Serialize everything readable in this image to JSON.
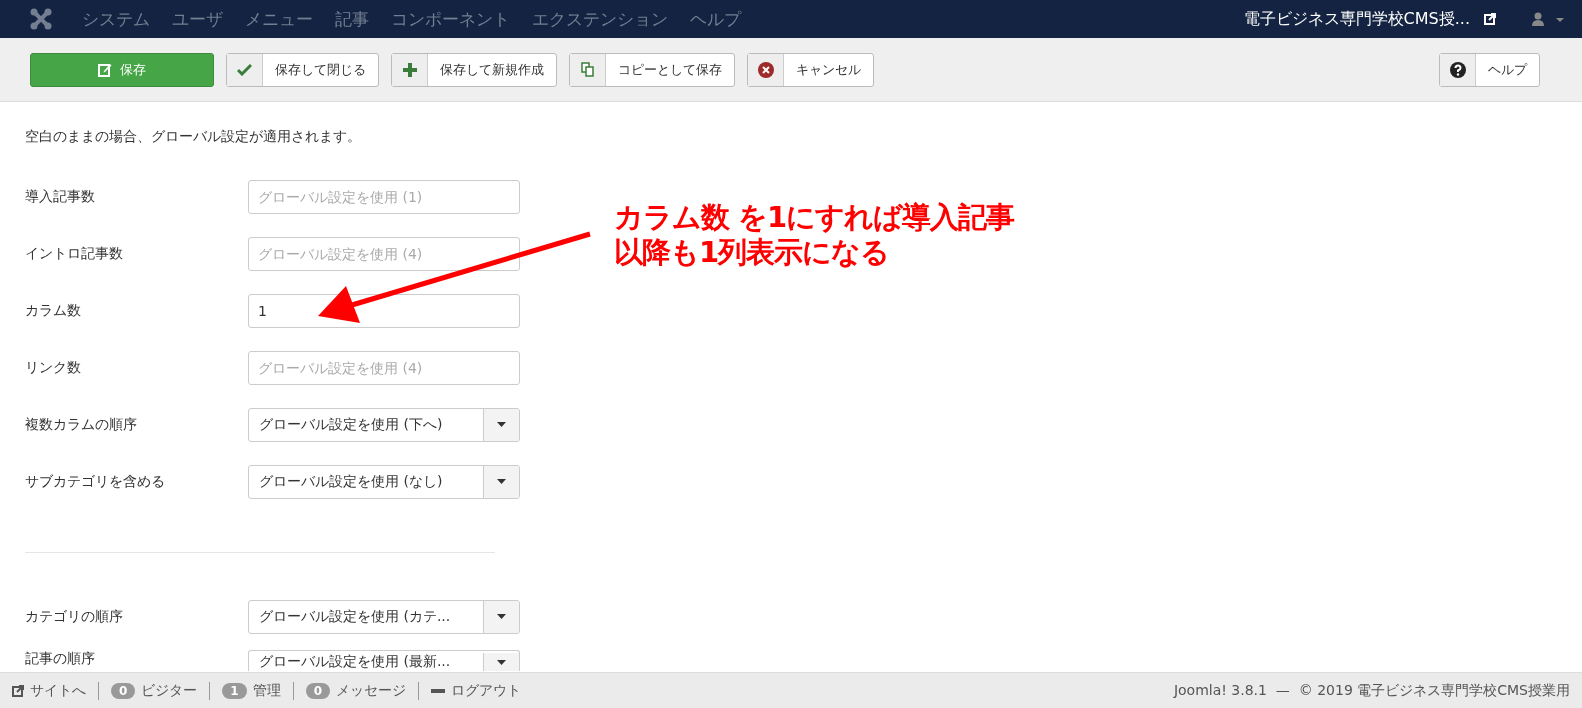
{
  "navbar": {
    "menu": [
      "システム",
      "ユーザ",
      "メニュー",
      "記事",
      "コンポーネント",
      "エクステンション",
      "ヘルプ"
    ],
    "site_title": "電子ビジネス専門学校CMS授..."
  },
  "toolbar": {
    "buttons": [
      {
        "label": "保存",
        "kind": "primary"
      },
      {
        "label": "保存して閉じる",
        "kind": "default"
      },
      {
        "label": "保存して新規作成",
        "kind": "default"
      },
      {
        "label": "コピーとして保存",
        "kind": "default"
      },
      {
        "label": "キャンセル",
        "kind": "default"
      }
    ],
    "help": {
      "label": "ヘルプ"
    }
  },
  "intro": "空白のままの場合、グローバル設定が適用されます。",
  "fields": [
    {
      "label": "導入記事数",
      "kind": "input",
      "placeholder": "グローバル設定を使用 (1)"
    },
    {
      "label": "イントロ記事数",
      "kind": "input",
      "placeholder": "グローバル設定を使用 (4)"
    },
    {
      "label": "カラム数",
      "kind": "input",
      "value": "1"
    },
    {
      "label": "リンク数",
      "kind": "input",
      "placeholder": "グローバル設定を使用 (4)"
    },
    {
      "label": "複数カラムの順序",
      "kind": "select",
      "value": "グローバル設定を使用 (下へ)"
    },
    {
      "label": "サブカテゴリを含める",
      "kind": "select",
      "value": "グローバル設定を使用 (なし)"
    }
  ],
  "fields_2": [
    {
      "label": "カテゴリの順序",
      "kind": "select",
      "value": "グローバル設定を使用 (カテ..."
    },
    {
      "label": "記事の順序",
      "kind": "select",
      "value": "グローバル設定を使用 (最新..."
    }
  ],
  "annotation": {
    "lines": [
      "カラム数 を1にすれば導入記事",
      "以降も1列表示になる"
    ]
  },
  "status_bar": {
    "items": [
      {
        "kind": "link",
        "label": "サイトへ"
      },
      {
        "kind": "count",
        "count": "0",
        "label": "ビジター"
      },
      {
        "kind": "count",
        "count": "1",
        "label": "管理"
      },
      {
        "kind": "count",
        "count": "0",
        "label": "メッセージ"
      },
      {
        "kind": "logout",
        "label": "ログアウト"
      }
    ],
    "copyright": "Joomla! 3.8.1  —  © 2019 電子ビジネス専門学校CMS授業用"
  }
}
